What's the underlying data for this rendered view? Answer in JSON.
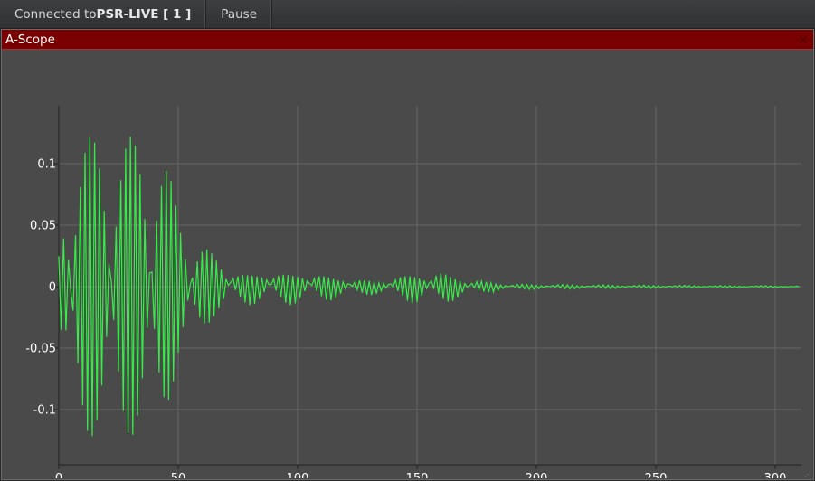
{
  "topbar": {
    "connected_prefix": "Connected to ",
    "connection_name": "PSR-LIVE [ 1 ]",
    "pause_label": "Pause"
  },
  "window": {
    "title": "A-Scope",
    "close_glyph": "×"
  },
  "colors": {
    "title_bar": "#7a0000",
    "plot_bg": "#4a4a4a",
    "trace": "#33ee44",
    "grid": "#666666"
  },
  "chart_data": {
    "type": "line",
    "title": "",
    "xlabel": "",
    "ylabel": "",
    "xlim": [
      0,
      310
    ],
    "ylim": [
      -0.145,
      0.145
    ],
    "grid": true,
    "legend": "none",
    "x_ticks": [
      0,
      50,
      100,
      150,
      200,
      250,
      300
    ],
    "x_tick_labels": [
      "0",
      "50",
      "100",
      "150",
      "200",
      "250",
      "300"
    ],
    "y_ticks": [
      0.1,
      0.05,
      0,
      -0.05,
      -0.1
    ],
    "y_tick_labels": [
      "0.1",
      "0.05",
      "0",
      "-0.05",
      "-0.1"
    ],
    "series": [
      {
        "color": "#33ee44",
        "sample_count": 311,
        "envelope": [
          {
            "x": 0,
            "amp": 0.03
          },
          {
            "x": 3,
            "amp": 0.09
          },
          {
            "x": 6,
            "amp": 0.122
          },
          {
            "x": 40,
            "amp": 0.122
          },
          {
            "x": 45,
            "amp": 0.1
          },
          {
            "x": 50,
            "amp": 0.065
          },
          {
            "x": 58,
            "amp": 0.04
          },
          {
            "x": 65,
            "amp": 0.025
          },
          {
            "x": 75,
            "amp": 0.012
          },
          {
            "x": 90,
            "amp": 0.012
          },
          {
            "x": 105,
            "amp": 0.012
          },
          {
            "x": 120,
            "amp": 0.007
          },
          {
            "x": 135,
            "amp": 0.005
          },
          {
            "x": 150,
            "amp": 0.012
          },
          {
            "x": 160,
            "amp": 0.012
          },
          {
            "x": 175,
            "amp": 0.005
          },
          {
            "x": 190,
            "amp": 0.002
          },
          {
            "x": 220,
            "amp": 0.0015
          },
          {
            "x": 260,
            "amp": 0.001
          },
          {
            "x": 310,
            "amp": 0.0005
          }
        ]
      }
    ]
  }
}
